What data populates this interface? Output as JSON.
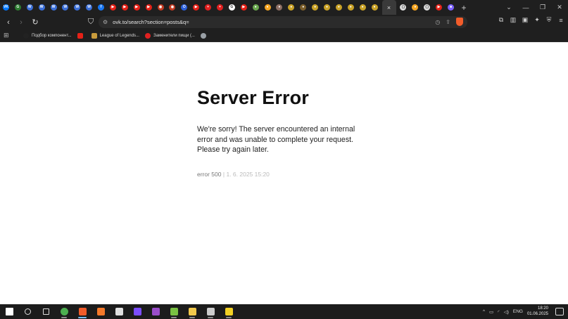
{
  "browser": {
    "tabs": [
      {
        "icon": "vk-icon",
        "color": "#0077ff",
        "glyph": "VK"
      },
      {
        "icon": "generic-icon",
        "color": "#2e7d32",
        "glyph": "G"
      },
      {
        "icon": "w-icon",
        "color": "#3b6fd8",
        "glyph": "W"
      },
      {
        "icon": "w-icon",
        "color": "#3b6fd8",
        "glyph": "W"
      },
      {
        "icon": "w-icon",
        "color": "#3b6fd8",
        "glyph": "W"
      },
      {
        "icon": "w-icon",
        "color": "#3b6fd8",
        "glyph": "W"
      },
      {
        "icon": "w-icon",
        "color": "#3b6fd8",
        "glyph": "W"
      },
      {
        "icon": "w-icon",
        "color": "#3b6fd8",
        "glyph": "W"
      },
      {
        "icon": "f-icon",
        "color": "#1877f2",
        "glyph": "f"
      },
      {
        "icon": "youtube-icon",
        "color": "#e62117",
        "glyph": "▶"
      },
      {
        "icon": "youtube-icon",
        "color": "#e62117",
        "glyph": "▶"
      },
      {
        "icon": "youtube-icon",
        "color": "#e62117",
        "glyph": "▶"
      },
      {
        "icon": "youtube-icon",
        "color": "#e62117",
        "glyph": "▶"
      },
      {
        "icon": "dota-icon",
        "color": "#c23b22",
        "glyph": "◉"
      },
      {
        "icon": "dota-icon",
        "color": "#c23b22",
        "glyph": "◉"
      },
      {
        "icon": "opera-icon",
        "color": "#2b5fd9",
        "glyph": "O"
      },
      {
        "icon": "youtube-icon",
        "color": "#e62117",
        "glyph": "▶"
      },
      {
        "icon": "plus-red-icon",
        "color": "#e02020",
        "glyph": "+"
      },
      {
        "icon": "plus-red-icon",
        "color": "#e02020",
        "glyph": "+"
      },
      {
        "icon": "google-icon",
        "color": "#ffffff",
        "glyph": "G"
      },
      {
        "icon": "youtube-icon",
        "color": "#e62117",
        "glyph": "▶"
      },
      {
        "icon": "round-icon",
        "color": "#6aa84f",
        "glyph": "●"
      },
      {
        "icon": "orange-icon",
        "color": "#f5a623",
        "glyph": "●"
      },
      {
        "icon": "round-icon",
        "color": "#8d6e63",
        "glyph": "●"
      },
      {
        "icon": "round-icon",
        "color": "#c9a227",
        "glyph": "●"
      },
      {
        "icon": "round-icon",
        "color": "#7b5e2b",
        "glyph": "●"
      },
      {
        "icon": "round-icon",
        "color": "#c9a227",
        "glyph": "●"
      },
      {
        "icon": "round-icon",
        "color": "#c9a227",
        "glyph": "●"
      },
      {
        "icon": "round-icon",
        "color": "#c9a227",
        "glyph": "●"
      },
      {
        "icon": "round-icon",
        "color": "#c9a227",
        "glyph": "●"
      },
      {
        "icon": "round-icon",
        "color": "#c9a227",
        "glyph": "●"
      },
      {
        "icon": "round-icon",
        "color": "#c9a227",
        "glyph": "●"
      }
    ],
    "tabs_after": [
      {
        "icon": "ovk-icon",
        "color": "#dcdcdc",
        "glyph": "▢"
      },
      {
        "icon": "orange-icon",
        "color": "#f5a623",
        "glyph": "●"
      },
      {
        "icon": "ovk-icon",
        "color": "#dcdcdc",
        "glyph": "▢"
      },
      {
        "icon": "youtube-icon",
        "color": "#e62117",
        "glyph": "▶"
      },
      {
        "icon": "twitch-icon",
        "color": "#7b61ff",
        "glyph": "■"
      }
    ],
    "active_tab_close": "×",
    "new_tab": "+",
    "window_controls": {
      "tabs_menu": "⌄",
      "minimize": "—",
      "maximize": "❐",
      "close": "✕"
    },
    "toolbar": {
      "back": "‹",
      "forward": "›",
      "reload": "↻",
      "bookmark": "⛉",
      "url": "ovk.to/search?section=posts&q="
    },
    "bookmarks": [
      {
        "icon": "dark-icon",
        "color": "#222222",
        "label": "Подбор компонент..."
      },
      {
        "icon": "youtube-icon",
        "color": "#e62117",
        "label": ""
      },
      {
        "icon": "lol-icon",
        "color": "#c89b3c",
        "label": "League of Legends..."
      },
      {
        "icon": "red-dot-icon",
        "color": "#e02020",
        "label": "Заменители пищи (..."
      },
      {
        "icon": "globe-icon",
        "color": "#9aa0a6",
        "label": ""
      }
    ]
  },
  "page": {
    "title": "Server Error",
    "message": "We're sorry! The server encountered an internal error and was unable to complete your request. Please try again later.",
    "error_code": "error 500",
    "separator": "|",
    "timestamp": "1. 6. 2025 15:20"
  },
  "taskbar": {
    "apps": [
      {
        "icon": "windows-start-icon",
        "color": "#ffffff",
        "state": ""
      },
      {
        "icon": "search-icon",
        "color": "#dddddd",
        "state": ""
      },
      {
        "icon": "task-view-icon",
        "color": "#dddddd",
        "state": ""
      },
      {
        "icon": "chrome-icon",
        "color": "#4caf50",
        "state": "running"
      },
      {
        "icon": "brave-icon",
        "color": "#f25c2a",
        "state": "active"
      },
      {
        "icon": "blender-icon",
        "color": "#f5792a",
        "state": ""
      },
      {
        "icon": "store-icon",
        "color": "#e0e0e0",
        "state": ""
      },
      {
        "icon": "gem-icon",
        "color": "#7c4dff",
        "state": ""
      },
      {
        "icon": "visual-studio-icon",
        "color": "#9b4dca",
        "state": ""
      },
      {
        "icon": "tor-icon",
        "color": "#7ac143",
        "state": "running"
      },
      {
        "icon": "file-explorer-icon",
        "color": "#f2c94c",
        "state": "running"
      },
      {
        "icon": "terminal-icon",
        "color": "#cccccc",
        "state": "running"
      },
      {
        "icon": "app-yellow-icon",
        "color": "#f2d024",
        "state": "running"
      }
    ],
    "tray": {
      "chevron": "^",
      "lang": "ENG"
    },
    "time": "18:20",
    "date": "01.06.2025"
  }
}
